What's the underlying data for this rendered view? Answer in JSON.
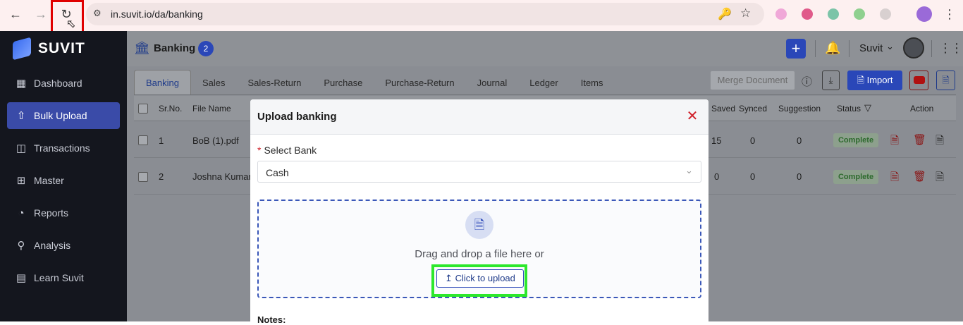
{
  "browser": {
    "url": "in.suvit.io/da/banking"
  },
  "sidebar": {
    "logo_text": "SUVIT",
    "items": [
      {
        "label": "Dashboard",
        "icon": "dashboard-icon"
      },
      {
        "label": "Bulk Upload",
        "icon": "upload-icon"
      },
      {
        "label": "Transactions",
        "icon": "transactions-icon"
      },
      {
        "label": "Master",
        "icon": "master-icon"
      },
      {
        "label": "Reports",
        "icon": "pie-chart-icon"
      },
      {
        "label": "Analysis",
        "icon": "analysis-icon"
      },
      {
        "label": "Learn Suvit",
        "icon": "book-icon"
      }
    ],
    "active_index": 1
  },
  "header": {
    "title": "Banking",
    "count": "2",
    "user": "Suvit"
  },
  "tabs": [
    "Banking",
    "Sales",
    "Sales-Return",
    "Purchase",
    "Purchase-Return",
    "Journal",
    "Ledger",
    "Items"
  ],
  "toolbar": {
    "merge_label": "Merge Document",
    "import_label": "Import"
  },
  "table": {
    "headers": {
      "srno": "Sr.No.",
      "file_name": "File Name",
      "saved": "Saved",
      "synced": "Synced",
      "suggestion": "Suggestion",
      "status": "Status",
      "action": "Action"
    },
    "rows": [
      {
        "srno": "1",
        "file_name": "BoB (1).pdf",
        "saved": "15",
        "synced": "0",
        "suggestion": "0",
        "status": "Complete"
      },
      {
        "srno": "2",
        "file_name": "Joshna Kumar",
        "saved": "0",
        "synced": "0",
        "suggestion": "0",
        "status": "Complete"
      }
    ]
  },
  "modal": {
    "title": "Upload banking",
    "select_label": "Select Bank",
    "select_value": "Cash",
    "drop_text": "Drag and drop a file here or",
    "upload_label": "Click to upload",
    "notes_label": "Notes:"
  },
  "colors": {
    "accent": "#2a47b8",
    "danger": "#d0202a",
    "highlight_red": "#e00000",
    "highlight_green": "#2ce82c"
  }
}
